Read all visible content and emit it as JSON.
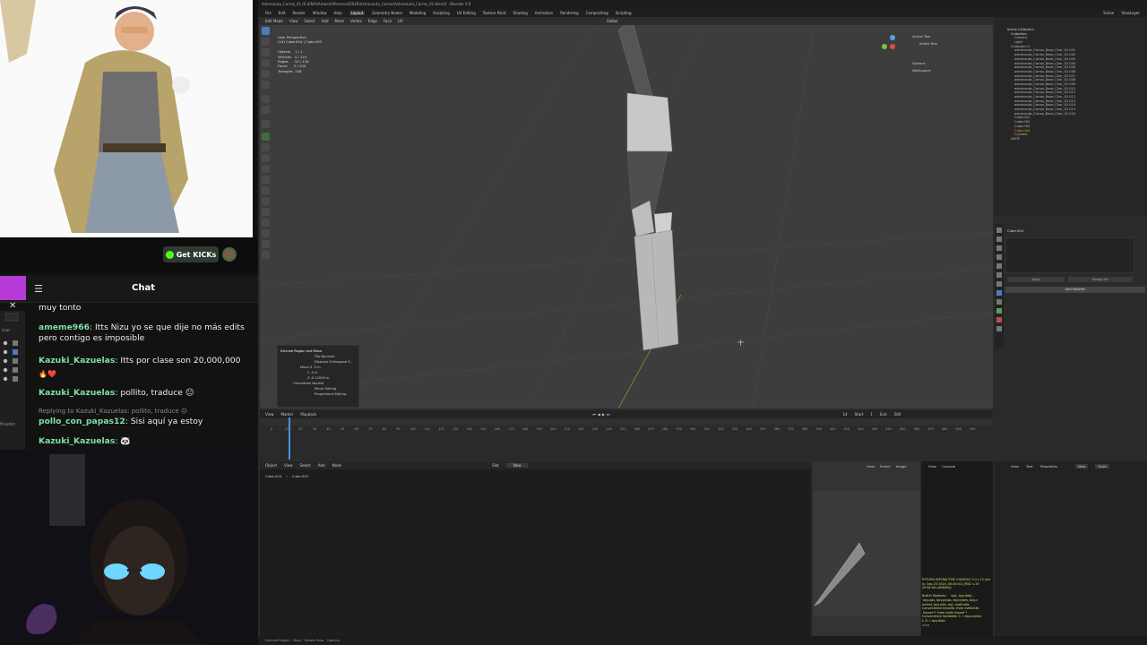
{
  "stream": {
    "get_kicks_label": "Get KICKs",
    "chat_title": "Chat",
    "messages": [
      {
        "user": "",
        "text": "muy tonto"
      },
      {
        "user": "ameme966",
        "text": "Itts Nizu yo se que dije no más edits pero contigo es imposible"
      },
      {
        "user": "Kazuki_Kazuelas",
        "text": "Itts por clase son 20,000,000"
      },
      {
        "user": "",
        "text": "🔥❤️"
      },
      {
        "user": "Kazuki_Kazuelas",
        "text": "pollito, traduce 😐"
      },
      {
        "reply": "Replying to Kazuki_Kazuelas: pollito, traduce 😐"
      },
      {
        "user": "pollo_con_papas12",
        "text": "Sisi aquí ya estoy"
      },
      {
        "user": "Kazuki_Kazuelas",
        "text": "🐼"
      }
    ],
    "obs_labels": [
      "icar",
      "ficador"
    ]
  },
  "blender": {
    "window_title": "Astronauta_Carrox_01 [E:\\ENVI\\Artwork\\Personal\\2026\\Astronauta_Carrox\\Astronauta_Carrox_01.blend] - Blender 5.0",
    "menus": [
      "File",
      "Edit",
      "Render",
      "Window",
      "Help"
    ],
    "workspaces": [
      "Layout",
      "Geometry Nodes",
      "Modeling",
      "Sculpting",
      "UV Editing",
      "Texture Paint",
      "Shading",
      "Animation",
      "Rendering",
      "Compositing",
      "Scripting"
    ],
    "active_workspace": "Layout",
    "viewport_menu": [
      "Edit Mode",
      "View",
      "Select",
      "Add",
      "Mesh",
      "Vertex",
      "Edge",
      "Face",
      "UV"
    ],
    "transform_orient": "Global",
    "viewport_info": "User Perspective\n(14) Cube.004 | Cube.003\n\nObjects    1 / 1\nVertices   4 / 124\nEdges      10 / 134\nFaces      2 / 104\nTriangles  208",
    "operator_panel": {
      "title": "Extrude Region and Move",
      "rows": [
        "Flip Normals",
        "Dissolve Orthogonal E...",
        "Move X  -0 m",
        "Y  -0 m",
        "Z  -0.12009 m",
        "Orientation  Normal",
        "Mirror Editing",
        "Proportional Editing"
      ]
    },
    "tool_panel": [
      "Active Tool",
      "Select Box",
      "Options",
      "Workspace"
    ],
    "outliner": {
      "title": "Scene Collection",
      "items": [
        "Collection",
        "Camera",
        "Light",
        "Collection.4",
        "astronauta_Carrox_Base_Char_01.001",
        "astronauta_Carrox_Base_Char_01.002",
        "astronauta_Carrox_Base_Char_01.003",
        "astronauta_Carrox_Base_Char_01.004",
        "astronauta_Carrox_Base_Char_01.005",
        "astronauta_Carrox_Base_Char_01.006",
        "astronauta_Carrox_Base_Char_01.007",
        "astronauta_Carrox_Base_Char_01.008",
        "astronauta_Carrox_Base_Char_01.009",
        "astronauta_Carrox_Base_Char_01.010",
        "astronauta_Carrox_Base_Char_01.011",
        "astronauta_Carrox_Base_Char_01.012",
        "astronauta_Carrox_Base_Char_01.013",
        "astronauta_Carrox_Base_Char_01.014",
        "astronauta_Carrox_Base_Char_01.015",
        "astronauta_Carrox_Base_Char_01.016",
        "Cube.001",
        "Cube.002",
        "Cube.003",
        "Cube.004",
        "Cylinder",
        "GEOP"
      ],
      "scene": "Scene",
      "view_layer": "ViewLayer"
    },
    "properties": {
      "object": "Cube.004",
      "buttons": [
        "Apply",
        "Assign Set",
        "Add Modifier"
      ]
    },
    "timeline": {
      "menus": [
        "View",
        "Marker",
        "Playback"
      ],
      "frame": "14",
      "start": "1",
      "end": "500",
      "ticks": [
        "0",
        "10",
        "20",
        "30",
        "40",
        "50",
        "60",
        "70",
        "80",
        "90",
        "100",
        "110",
        "120",
        "130",
        "140",
        "150",
        "160",
        "170",
        "180",
        "190",
        "200",
        "210",
        "220",
        "230",
        "240",
        "250",
        "260",
        "270",
        "280",
        "290",
        "300",
        "310",
        "320",
        "330",
        "340",
        "350",
        "360",
        "370",
        "380",
        "390",
        "400",
        "410",
        "420",
        "430",
        "440",
        "450",
        "460",
        "470",
        "480",
        "490",
        "500"
      ]
    },
    "node_editor": {
      "menus": [
        "Object",
        "View",
        "Select",
        "Add",
        "Node"
      ],
      "slot": "Slot",
      "new": "New",
      "breadcrumb": [
        "Cube.004",
        "Cube.003"
      ]
    },
    "uv_menus": [
      "View",
      "Select",
      "Image"
    ],
    "console_menus": [
      "View",
      "Console"
    ],
    "console_text": "PYTHON INTERACTIVE CONSOLE 3.11.13 (ma\nin, Sep 23 2025, 00:00:01) [MSC v.19\n29 64 bit (AMD64)]\n\nBuiltin Modules:     bpy, bpy.data,\n bpy.ops, bpy.props, bpy.types, bpy.c\nontext, bpy.utils, bgl, mathutils\nConvenience Imports: from mathutils\n import *; from math import *\nConvenience Variables: C = bpy.contex\nt, D = bpy.data\n>>> ",
    "text_editor_menus": [
      "View",
      "Text",
      "Templates"
    ],
    "text_new": "New",
    "text_open": "Open",
    "status": [
      "Extrude Region",
      "Move",
      "Rotate View",
      "Options"
    ]
  }
}
